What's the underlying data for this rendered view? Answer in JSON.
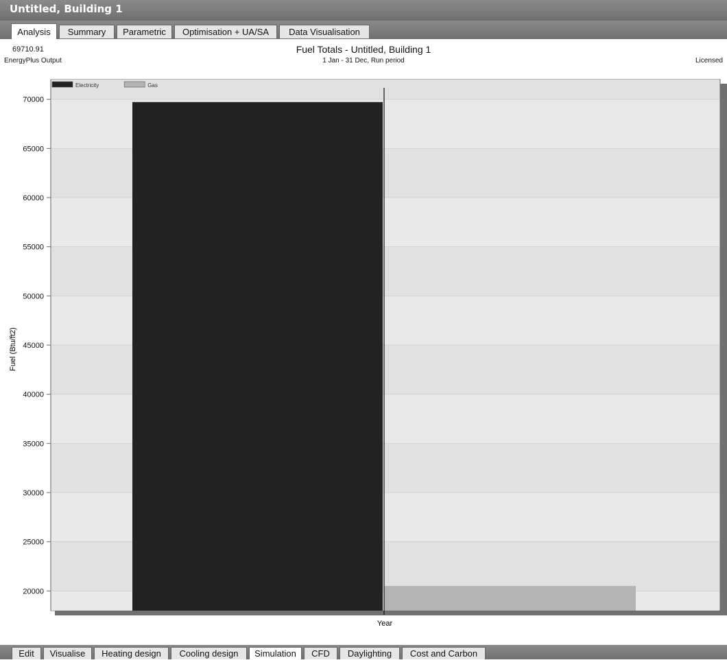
{
  "window": {
    "title": "Untitled, Building 1"
  },
  "top_tabs": [
    {
      "label": "Analysis",
      "active": true
    },
    {
      "label": "Summary",
      "active": false
    },
    {
      "label": "Parametric",
      "active": false
    },
    {
      "label": "Optimisation + UA/SA",
      "active": false
    },
    {
      "label": "Data Visualisation",
      "active": false
    }
  ],
  "header": {
    "value_readout": "69710.91",
    "source": "EnergyPlus Output",
    "license": "Licensed"
  },
  "bottom_tabs": [
    {
      "label": "Edit",
      "active": false
    },
    {
      "label": "Visualise",
      "active": false
    },
    {
      "label": "Heating design",
      "active": false
    },
    {
      "label": "Cooling design",
      "active": false
    },
    {
      "label": "Simulation",
      "active": true
    },
    {
      "label": "CFD",
      "active": false
    },
    {
      "label": "Daylighting",
      "active": false
    },
    {
      "label": "Cost and Carbon",
      "active": false
    }
  ],
  "chart_data": {
    "type": "bar",
    "title": "Fuel Totals - Untitled, Building 1",
    "subtitle": "1 Jan - 31 Dec, Run period",
    "xlabel": "Year",
    "ylabel": "Fuel (Btu/ft2)",
    "categories": [
      ""
    ],
    "series": [
      {
        "name": "Electricity",
        "values": [
          69710.91
        ],
        "color": "#222222"
      },
      {
        "name": "Gas",
        "values": [
          20500
        ],
        "color": "#b4b4b4"
      }
    ],
    "ylim": [
      18000,
      72000
    ],
    "yticks": [
      20000,
      25000,
      30000,
      35000,
      40000,
      45000,
      50000,
      55000,
      60000,
      65000,
      70000
    ],
    "grid": true,
    "legend": "top-left"
  }
}
